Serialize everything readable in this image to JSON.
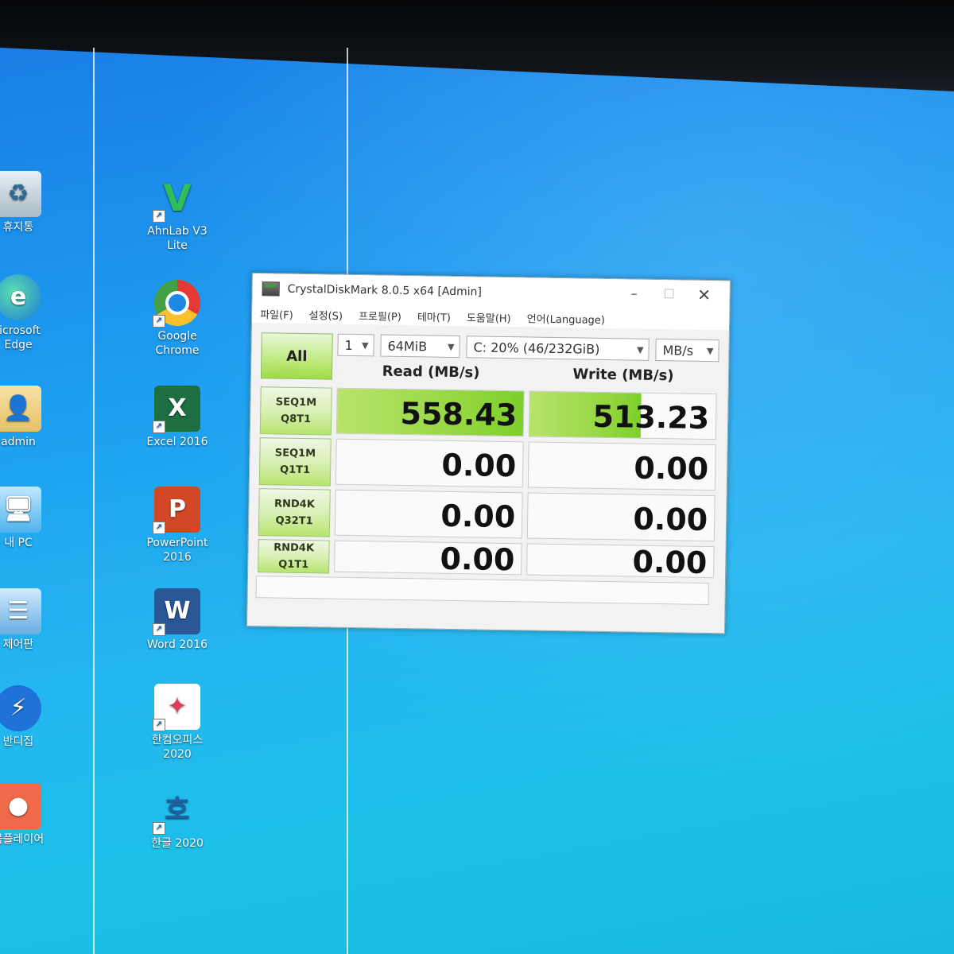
{
  "desktop": {
    "icons_left": [
      {
        "label": "휴지통",
        "icon": "recycle-bin-icon"
      },
      {
        "label": "licrosoft\nEdge",
        "icon": "edge-icon"
      },
      {
        "label": "admin",
        "icon": "user-folder-icon"
      },
      {
        "label": "내 PC",
        "icon": "computer-icon"
      },
      {
        "label": "제어판",
        "icon": "control-panel-icon"
      },
      {
        "label": "반디집",
        "icon": "bandizip-icon"
      },
      {
        "label": "곰플레이어",
        "icon": "gomplayer-icon"
      }
    ],
    "icons_mid": [
      {
        "label": "AhnLab V3\nLite",
        "icon": "v3-icon"
      },
      {
        "label": "Google\nChrome",
        "icon": "chrome-icon"
      },
      {
        "label": "Excel 2016",
        "icon": "excel-icon"
      },
      {
        "label": "PowerPoint\n2016",
        "icon": "powerpoint-icon"
      },
      {
        "label": "Word 2016",
        "icon": "word-icon"
      },
      {
        "label": "한컴오피스\n2020",
        "icon": "hancom-office-icon"
      },
      {
        "label": "한글 2020",
        "icon": "hangul-icon"
      }
    ]
  },
  "window": {
    "title": "CrystalDiskMark 8.0.5 x64 [Admin]",
    "menu": [
      "파일(F)",
      "설정(S)",
      "프로필(P)",
      "테마(T)",
      "도움말(H)",
      "언어(Language)"
    ],
    "controls": {
      "all_label": "All",
      "count": "1",
      "size": "64MiB",
      "drive": "C: 20% (46/232GiB)",
      "unit": "MB/s"
    },
    "headers": {
      "read": "Read (MB/s)",
      "write": "Write (MB/s)"
    },
    "tests": [
      {
        "line1": "SEQ1M",
        "line2": "Q8T1",
        "read": "558.43",
        "write": "513.23",
        "read_fill": 1.0,
        "write_fill": 0.6
      },
      {
        "line1": "SEQ1M",
        "line2": "Q1T1",
        "read": "0.00",
        "write": "0.00",
        "read_fill": 0,
        "write_fill": 0
      },
      {
        "line1": "RND4K",
        "line2": "Q32T1",
        "read": "0.00",
        "write": "0.00",
        "read_fill": 0,
        "write_fill": 0
      },
      {
        "line1": "RND4K",
        "line2": "Q1T1",
        "read": "0.00",
        "write": "0.00",
        "read_fill": 0,
        "write_fill": 0
      }
    ],
    "status": ""
  },
  "colors": {
    "accent_green": "#9fdc45",
    "desktop_blue": "#1d9ff0"
  }
}
